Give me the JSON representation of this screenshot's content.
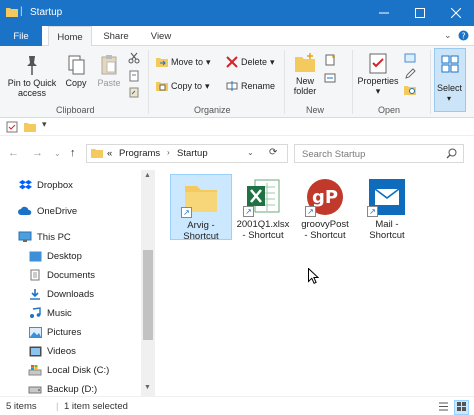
{
  "window": {
    "title": "Startup"
  },
  "tabs": {
    "file": "File",
    "home": "Home",
    "share": "Share",
    "view": "View"
  },
  "ribbon": {
    "clipboard": {
      "pin_label_1": "Pin to Quick",
      "pin_label_2": "access",
      "copy": "Copy",
      "paste": "Paste",
      "group": "Clipboard"
    },
    "organize": {
      "move_to": "Move to",
      "copy_to": "Copy to",
      "delete": "Delete",
      "rename": "Rename",
      "group": "Organize"
    },
    "new": {
      "new_folder_1": "New",
      "new_folder_2": "folder",
      "group": "New"
    },
    "open": {
      "properties": "Properties",
      "group": "Open"
    },
    "select": {
      "label": "Select"
    }
  },
  "address": {
    "prefix": "«",
    "crumbs": [
      "Programs",
      "Startup"
    ],
    "search_placeholder": "Search Startup"
  },
  "nav": {
    "items": [
      {
        "label": "Dropbox",
        "icon": "dropbox-icon"
      },
      {
        "label": "OneDrive",
        "icon": "onedrive-icon"
      },
      {
        "label": "This PC",
        "icon": "pc-icon"
      },
      {
        "label": "Desktop",
        "icon": "desktop-icon"
      },
      {
        "label": "Documents",
        "icon": "documents-icon"
      },
      {
        "label": "Downloads",
        "icon": "downloads-icon"
      },
      {
        "label": "Music",
        "icon": "music-icon"
      },
      {
        "label": "Pictures",
        "icon": "pictures-icon"
      },
      {
        "label": "Videos",
        "icon": "videos-icon"
      },
      {
        "label": "Local Disk (C:)",
        "icon": "local-disk-icon"
      },
      {
        "label": "Backup (D:)",
        "icon": "backup-drive-icon"
      }
    ]
  },
  "files": [
    {
      "line1": "Arvig -",
      "line2": "Shortcut",
      "icon": "folder-icon"
    },
    {
      "line1": "2001Q1.xlsx",
      "line2": "- Shortcut",
      "icon": "excel-icon"
    },
    {
      "line1": "groovyPost",
      "line2": "- Shortcut",
      "icon": "groovypost-icon"
    },
    {
      "line1": "Mail -",
      "line2": "Shortcut",
      "icon": "mail-icon"
    }
  ],
  "status": {
    "items": "5 items",
    "selected": "1 item selected"
  },
  "colors": {
    "accent": "#1b73c7",
    "selection": "#cce8ff",
    "folder": "#f4c95d",
    "excel": "#1f7244",
    "mail": "#0f6cbd",
    "groovypost": "#c0392b"
  }
}
